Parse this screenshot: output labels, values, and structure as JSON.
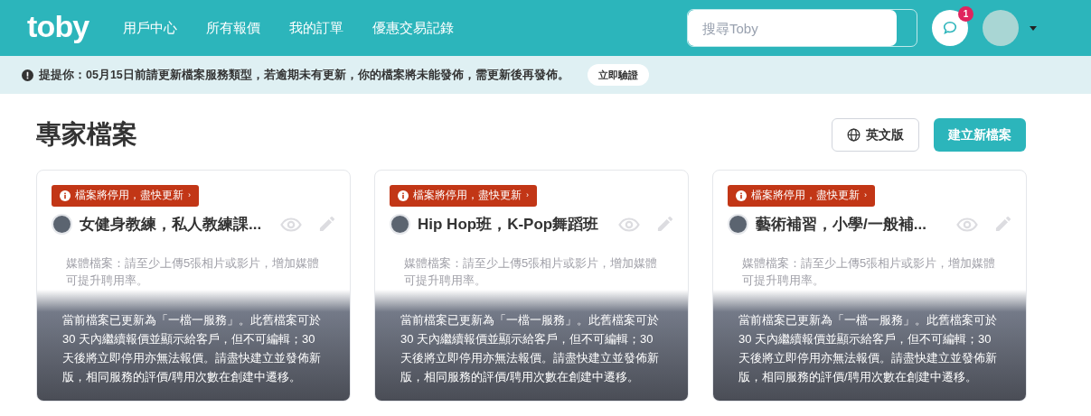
{
  "header": {
    "logo": "toby",
    "nav": [
      "用戶中心",
      "所有報價",
      "我的訂單",
      "優惠交易記錄"
    ],
    "search": {
      "placeholder": "搜尋Toby"
    },
    "messages": {
      "badge": "1"
    }
  },
  "notice": {
    "text": "提提你：05月15日前請更新檔案服務類型，若逾期未有更新，你的檔案將未能發佈，需更新後再發佈。",
    "button": "立即驗證"
  },
  "page": {
    "title": "專家檔案",
    "language_button": "英文版",
    "create_button": "建立新檔案"
  },
  "cards": [
    {
      "warning": "檔案將停用，盡快更新",
      "chevron": "›",
      "title": "女健身教練，私人教練課...",
      "media_hint": "媒體檔案：請至少上傳5張相片或影片，增加媒體可提升聘用率。",
      "overlay": "當前檔案已更新為「一檔一服務」。此舊檔案可於 30 天內繼續報價並顯示給客戶，但不可編輯；30 天後將立即停用亦無法報價。請盡快建立並發佈新版，相同服務的評價/聘用次數在創建中遷移。"
    },
    {
      "warning": "檔案將停用，盡快更新",
      "chevron": "›",
      "title": "Hip Hop班，K-Pop舞蹈班",
      "media_hint": "媒體檔案：請至少上傳5張相片或影片，增加媒體可提升聘用率。",
      "overlay": "當前檔案已更新為「一檔一服務」。此舊檔案可於 30 天內繼續報價並顯示給客戶，但不可編輯；30 天後將立即停用亦無法報價。請盡快建立並發佈新版，相同服務的評價/聘用次數在創建中遷移。"
    },
    {
      "warning": "檔案將停用，盡快更新",
      "chevron": "›",
      "title": "藝術補習，小學/一般補...",
      "media_hint": "媒體檔案：請至少上傳5張相片或影片，增加媒體可提升聘用率。",
      "overlay": "當前檔案已更新為「一檔一服務」。此舊檔案可於 30 天內繼續報價並顯示給客戶，但不可編輯；30 天後將立即停用亦無法報價。請盡快建立並發佈新版，相同服務的評價/聘用次數在創建中遷移。"
    }
  ]
}
